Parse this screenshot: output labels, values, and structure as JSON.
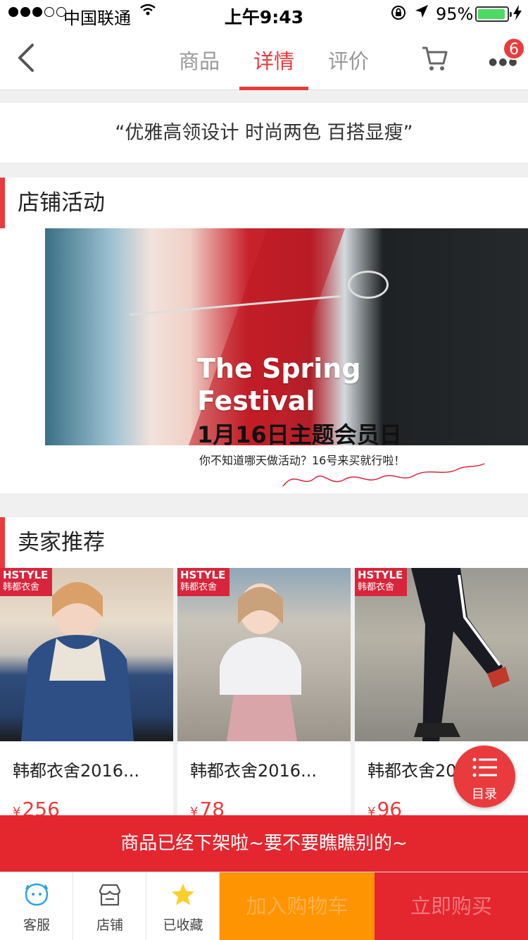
{
  "status_bar": {
    "carrier": "中国联通",
    "time": "上午9:43",
    "battery_percent": "95%"
  },
  "nav": {
    "tabs": [
      {
        "label": "商品",
        "active": false
      },
      {
        "label": "详情",
        "active": true
      },
      {
        "label": "评价",
        "active": false
      }
    ],
    "message_badge": "6",
    "accent_color": "#e93b3d"
  },
  "slogan": "“优雅高领设计 时尚两色 百搭显瘦”",
  "store_activity": {
    "title": "店铺活动",
    "banner_line1": "The Spring",
    "banner_line2": "Festival",
    "banner_main": "1月16日主题会员日",
    "banner_sub": "你不知道哪天做活动？16号来买就行啦！"
  },
  "seller_recommend": {
    "title": "卖家推荐",
    "items": [
      {
        "brand": "HSTYLE",
        "brand_cn": "韩都衣舍",
        "name": "韩都衣舍2016...",
        "currency": "¥",
        "price": "256"
      },
      {
        "brand": "HSTYLE",
        "brand_cn": "韩都衣舍",
        "name": "韩都衣舍2016...",
        "currency": "¥",
        "price": "78"
      },
      {
        "brand": "HSTYLE",
        "brand_cn": "韩都衣舍",
        "name": "韩都衣舍2016...",
        "currency": "¥",
        "price": "96"
      }
    ]
  },
  "catalog_button": "目录",
  "notice": "商品已经下架啦~要不要瞧瞧别的~",
  "bottom_bar": {
    "service": "客服",
    "store": "店铺",
    "favorited": "已收藏",
    "add_cart": "加入购物车",
    "buy_now": "立即购买"
  }
}
